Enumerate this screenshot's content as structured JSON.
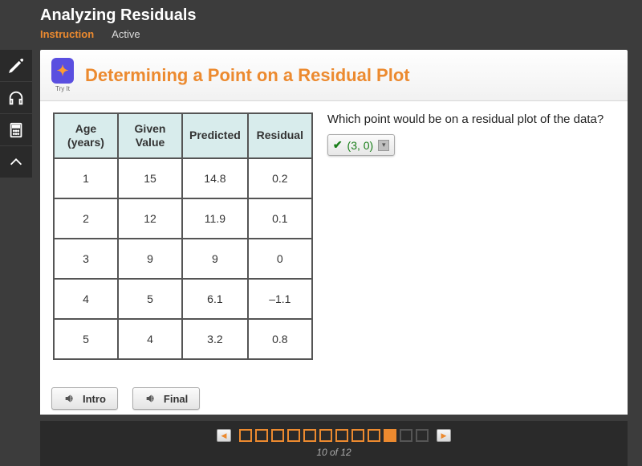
{
  "header": {
    "title": "Analyzing Residuals",
    "tabs": {
      "instruction": "Instruction",
      "active": "Active"
    }
  },
  "panel": {
    "tryit_label": "Try It",
    "title": "Determining a Point on a Residual Plot"
  },
  "table": {
    "headers": {
      "age": "Age (years)",
      "given": "Given Value",
      "predicted": "Predicted",
      "residual": "Residual"
    },
    "rows": [
      {
        "age": "1",
        "given": "15",
        "predicted": "14.8",
        "residual": "0.2"
      },
      {
        "age": "2",
        "given": "12",
        "predicted": "11.9",
        "residual": "0.1"
      },
      {
        "age": "3",
        "given": "9",
        "predicted": "9",
        "residual": "0"
      },
      {
        "age": "4",
        "given": "5",
        "predicted": "6.1",
        "residual": "–1.1"
      },
      {
        "age": "5",
        "given": "4",
        "predicted": "3.2",
        "residual": "0.8"
      }
    ]
  },
  "qa": {
    "question": "Which point would be on a residual plot of the data?",
    "selected": "(3, 0)"
  },
  "audio": {
    "intro": "Intro",
    "final": "Final"
  },
  "pager": {
    "current": 10,
    "total": 12,
    "label": "10 of 12"
  }
}
